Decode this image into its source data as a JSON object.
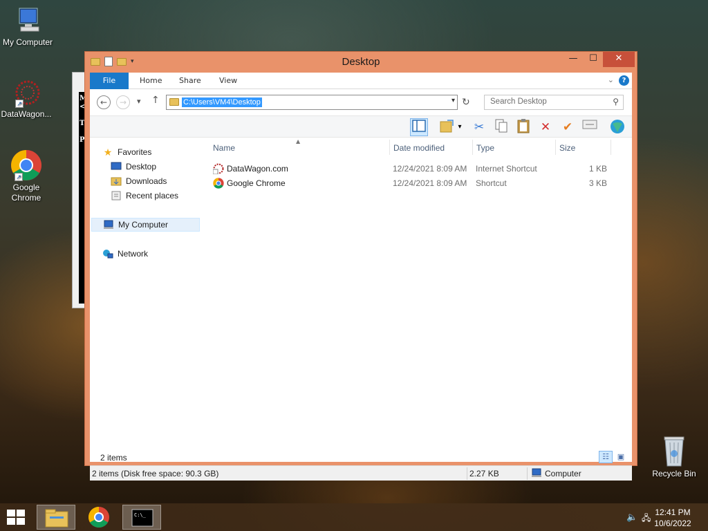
{
  "desktop": {
    "icons": [
      {
        "label": "My Computer"
      },
      {
        "label": "DataWagon..."
      },
      {
        "label": "Google Chrome"
      },
      {
        "label": "Recycle Bin"
      }
    ],
    "bg_window_chars": [
      "M",
      "<",
      "T",
      "P"
    ]
  },
  "window": {
    "title": "Desktop",
    "controls": {
      "minimize": "—",
      "maximize": "☐",
      "close": "✕"
    },
    "ribbon_tabs": [
      {
        "label": "File"
      },
      {
        "label": "Home"
      },
      {
        "label": "Share"
      },
      {
        "label": "View"
      }
    ],
    "address": {
      "path": "C:\\Users\\VM4\\Desktop"
    },
    "search": {
      "placeholder": "Search Desktop"
    },
    "nav_pane": {
      "favorites": "Favorites",
      "items": [
        {
          "label": "Desktop"
        },
        {
          "label": "Downloads"
        },
        {
          "label": "Recent places"
        }
      ],
      "my_computer": "My Computer",
      "network": "Network"
    },
    "columns": {
      "name": "Name",
      "date": "Date modified",
      "type": "Type",
      "size": "Size"
    },
    "files": [
      {
        "name": "DataWagon.com",
        "date": "12/24/2021 8:09 AM",
        "type": "Internet Shortcut",
        "size": "1 KB"
      },
      {
        "name": "Google Chrome",
        "date": "12/24/2021 8:09 AM",
        "type": "Shortcut",
        "size": "3 KB"
      }
    ],
    "item_count": "2 items",
    "statusbar": {
      "left": "2 items (Disk free space: 90.3 GB)",
      "size": "2.27 KB",
      "location": "Computer"
    }
  },
  "taskbar": {
    "clock": {
      "time": "12:41 PM",
      "date": "10/6/2022"
    }
  }
}
